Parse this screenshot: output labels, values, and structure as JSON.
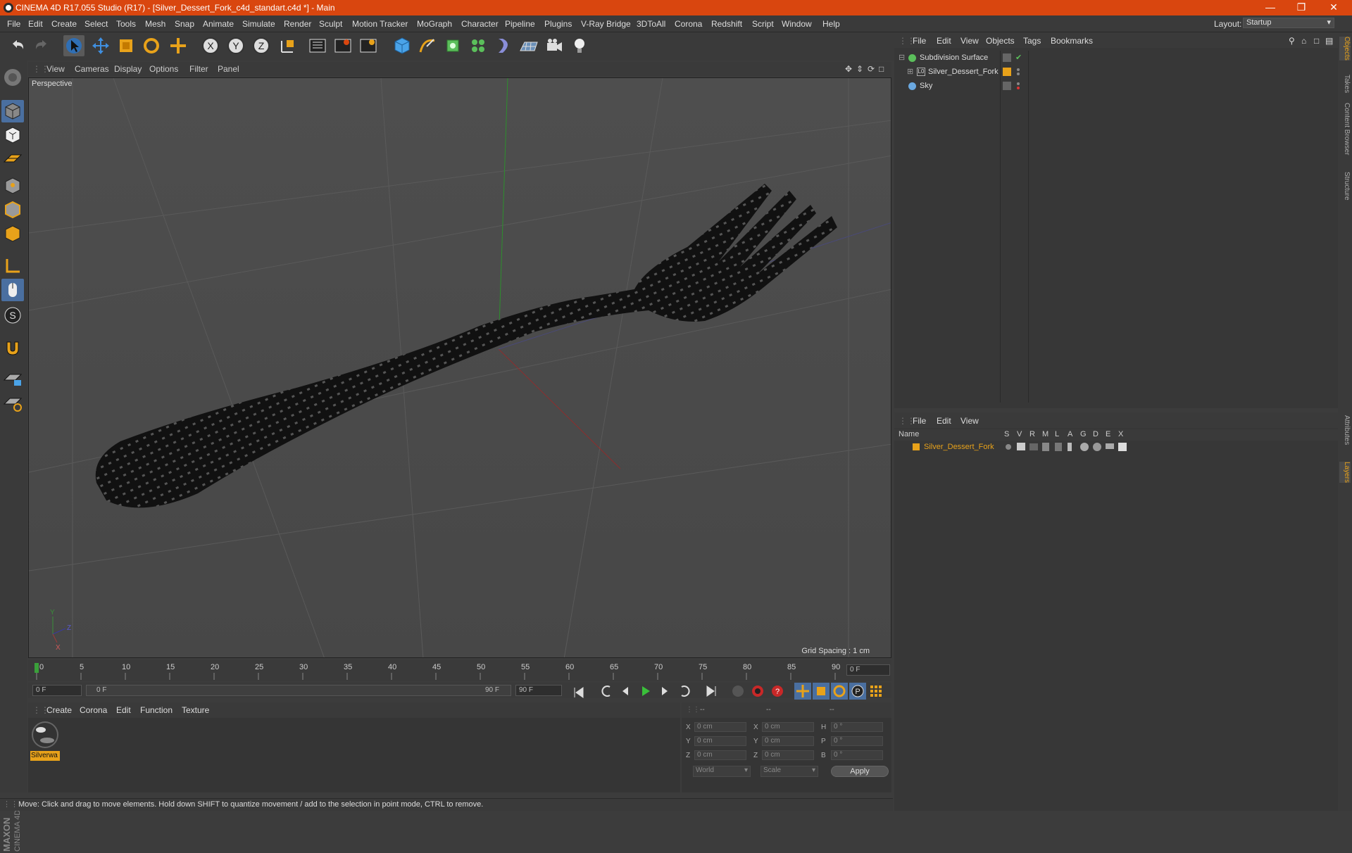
{
  "titlebar": {
    "title": "CINEMA 4D R17.055 Studio (R17) - [Silver_Dessert_Fork_c4d_standart.c4d *] - Main"
  },
  "menubar": {
    "items": [
      "File",
      "Edit",
      "Create",
      "Select",
      "Tools",
      "Mesh",
      "Snap",
      "Animate",
      "Simulate",
      "Render",
      "Sculpt",
      "Motion Tracker",
      "MoGraph",
      "Character",
      "Pipeline",
      "Plugins",
      "V-Ray Bridge",
      "3DToAll",
      "Corona",
      "Redshift",
      "Script",
      "Window",
      "Help"
    ],
    "layout_label": "Layout:",
    "layout_value": "Startup"
  },
  "viewport": {
    "menu": [
      "View",
      "Cameras",
      "Display",
      "Options",
      "Filter",
      "Panel"
    ],
    "label": "Perspective",
    "grid_spacing": "Grid Spacing : 1 cm"
  },
  "timeline": {
    "ticks": [
      "0",
      "5",
      "10",
      "15",
      "20",
      "25",
      "30",
      "35",
      "40",
      "45",
      "50",
      "55",
      "60",
      "65",
      "70",
      "75",
      "80",
      "85",
      "90"
    ],
    "frame_field": "0 F",
    "start_field": "0 F",
    "slider_left": "0 F",
    "slider_right": "90 F",
    "end_field": "90 F"
  },
  "material": {
    "menu": [
      "Create",
      "Corona",
      "Edit",
      "Function",
      "Texture"
    ],
    "swatch_label": "Silverwa"
  },
  "coords": {
    "header": [
      "--",
      "--",
      "--"
    ],
    "rows": [
      {
        "a": "X",
        "av": "0 cm",
        "b": "X",
        "bv": "0 cm",
        "c": "H",
        "cv": "0 °"
      },
      {
        "a": "Y",
        "av": "0 cm",
        "b": "Y",
        "bv": "0 cm",
        "c": "P",
        "cv": "0 °"
      },
      {
        "a": "Z",
        "av": "0 cm",
        "b": "Z",
        "bv": "0 cm",
        "c": "B",
        "cv": "0 °"
      }
    ],
    "world": "World",
    "scale": "Scale",
    "apply": "Apply"
  },
  "status": {
    "text": "Move: Click and drag to move elements. Hold down SHIFT to quantize movement / add to the selection in point mode, CTRL to remove."
  },
  "objects": {
    "menu": [
      "File",
      "Edit",
      "View",
      "Objects",
      "Tags",
      "Bookmarks"
    ],
    "items": [
      {
        "name": "Subdivision Surface"
      },
      {
        "name": "Silver_Dessert_Fork"
      },
      {
        "name": "Sky"
      }
    ]
  },
  "layers": {
    "menu": [
      "File",
      "Edit",
      "View"
    ],
    "columns": [
      "Name",
      "S",
      "V",
      "R",
      "M",
      "L",
      "A",
      "G",
      "D",
      "E",
      "X"
    ],
    "row": "Silver_Dessert_Fork"
  },
  "right_tabs": [
    "Objects",
    "Takes",
    "Content Browser",
    "Structure",
    "Attributes",
    "Layers"
  ],
  "colors": {
    "accent": "#d9460f",
    "layer": "#e8a21a"
  }
}
